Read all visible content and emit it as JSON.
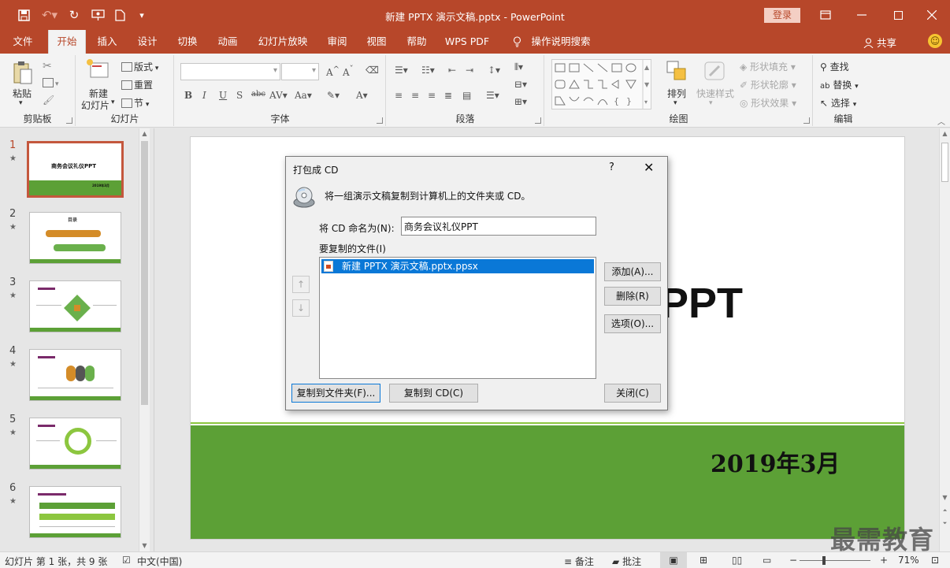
{
  "app": {
    "doc_title": "新建 PPTX 演示文稿.pptx  -  PowerPoint",
    "login": "登录"
  },
  "quick_access": {
    "save_icon": "save-icon",
    "undo_icon": "undo-icon",
    "redo_icon": "redo-icon",
    "present_icon": "present-icon",
    "new_icon": "new-file-icon",
    "more_icon": "customize-icon"
  },
  "tabs": [
    {
      "label": "文件"
    },
    {
      "label": "开始"
    },
    {
      "label": "插入"
    },
    {
      "label": "设计"
    },
    {
      "label": "切换"
    },
    {
      "label": "动画"
    },
    {
      "label": "幻灯片放映"
    },
    {
      "label": "审阅"
    },
    {
      "label": "视图"
    },
    {
      "label": "帮助"
    },
    {
      "label": "WPS PDF"
    },
    {
      "label": "操作说明搜索"
    }
  ],
  "active_tab": "开始",
  "share": "共享",
  "ribbon": {
    "clipboard": {
      "label": "剪贴板",
      "paste": "粘贴"
    },
    "slides": {
      "label": "幻灯片",
      "new_slide_1": "新建",
      "new_slide_2": "幻灯片",
      "layout": "版式",
      "reset": "重置",
      "section": "节"
    },
    "font": {
      "label": "字体"
    },
    "paragraph": {
      "label": "段落"
    },
    "drawing": {
      "label": "绘图",
      "arrange": "排列",
      "quick_styles": "快速样式",
      "shape_fill": "形状填充",
      "shape_outline": "形状轮廓",
      "shape_effects": "形状效果"
    },
    "editing": {
      "label": "编辑",
      "find": "查找",
      "replace": "替换",
      "select": "选择"
    }
  },
  "thumbnails": [
    {
      "num": "1",
      "title": "商务会议礼仪PPT",
      "date": "2019年3月"
    },
    {
      "num": "2",
      "title": "目录"
    },
    {
      "num": "3",
      "title": ""
    },
    {
      "num": "4",
      "title": ""
    },
    {
      "num": "5",
      "title": ""
    },
    {
      "num": "6",
      "title": ""
    }
  ],
  "slide": {
    "title_visible": "PPT",
    "date": "2019年3月"
  },
  "dialog": {
    "title": "打包成 CD",
    "help": "?",
    "close": "✕",
    "description": "将一组演示文稿复制到计算机上的文件夹或 CD。",
    "name_label": "将 CD 命名为(N):",
    "name_value": "商务会议礼仪PPT",
    "files_label": "要复制的文件(I)",
    "files": [
      "新建 PPTX 演示文稿.pptx.ppsx"
    ],
    "add": "添加(A)...",
    "remove": "删除(R)",
    "options": "选项(O)...",
    "copy_folder": "复制到文件夹(F)...",
    "copy_cd": "复制到 CD(C)",
    "close_btn": "关闭(C)"
  },
  "status": {
    "slide_info": "幻灯片 第 1 张，共 9 张",
    "language": "中文(中国)",
    "notes": "备注",
    "comments": "批注",
    "zoom": "71%",
    "zoom_level": 0.71
  },
  "watermark": "最需教育",
  "colors": {
    "accent": "#b7472a",
    "slide_green": "#5ca036",
    "selection": "#0a78d7"
  }
}
